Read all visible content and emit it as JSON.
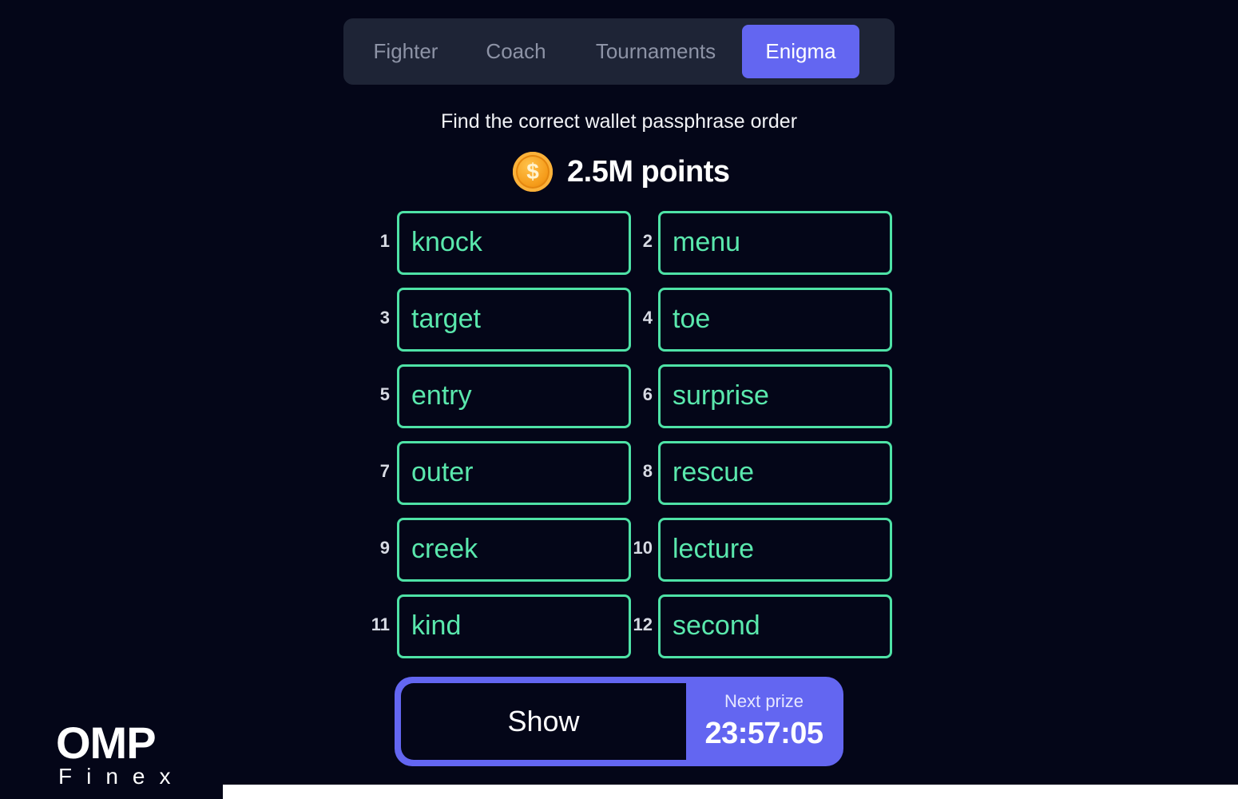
{
  "tabs": [
    {
      "label": "Fighter",
      "active": false
    },
    {
      "label": "Coach",
      "active": false
    },
    {
      "label": "Tournaments",
      "active": false
    },
    {
      "label": "Enigma",
      "active": true
    }
  ],
  "instruction": "Find the correct wallet passphrase order",
  "reward": {
    "icon": "dollar-coin-icon",
    "coin_symbol": "$",
    "points": "2.5M points"
  },
  "words": [
    {
      "num": "1",
      "word": "knock"
    },
    {
      "num": "2",
      "word": "menu"
    },
    {
      "num": "3",
      "word": "target"
    },
    {
      "num": "4",
      "word": "toe"
    },
    {
      "num": "5",
      "word": "entry"
    },
    {
      "num": "6",
      "word": "surprise"
    },
    {
      "num": "7",
      "word": "outer"
    },
    {
      "num": "8",
      "word": "rescue"
    },
    {
      "num": "9",
      "word": "creek"
    },
    {
      "num": "10",
      "word": "lecture"
    },
    {
      "num": "11",
      "word": "kind"
    },
    {
      "num": "12",
      "word": "second"
    }
  ],
  "action": {
    "show_label": "Show",
    "next_prize_label": "Next prize",
    "timer": "23:57:05"
  },
  "logo": {
    "main": "OMP",
    "sub": "Finex"
  },
  "colors": {
    "background": "#040618",
    "accent": "#6366f1",
    "word_border": "#4ee2a6",
    "word_text": "#5ae8ad",
    "tabbar": "#1e2436"
  }
}
